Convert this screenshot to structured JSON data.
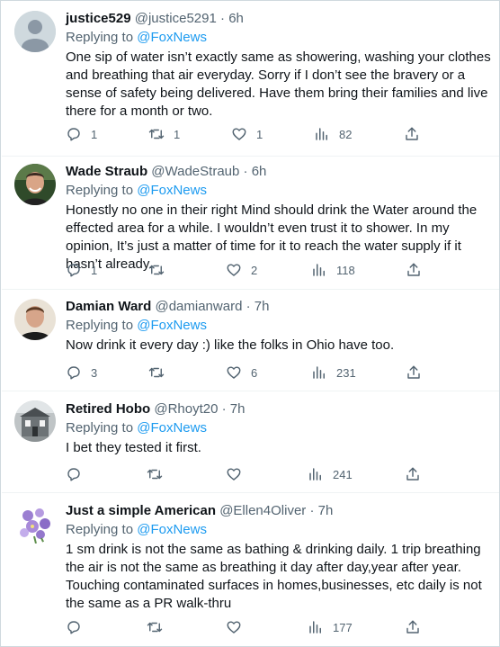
{
  "tweets": [
    {
      "name": "justice529",
      "handle": "@justice5291",
      "time": "6h",
      "replying_prefix": "Replying to",
      "replying_to": "@FoxNews",
      "text": "One sip of water isn’t exactly same as showering, washing your clothes and breathing that air everyday. Sorry if I don’t see the bravery or a sense of safety being delivered. Have them bring their families and live there for a month or two.",
      "replies": "1",
      "retweets": "1",
      "likes": "1",
      "views": "82",
      "avatar": "default-avatar"
    },
    {
      "name": "Wade Straub",
      "handle": "@WadeStraub",
      "time": "6h",
      "replying_prefix": "Replying to",
      "replying_to": "@FoxNews",
      "text": "Honestly no one in their right Mind should drink the Water around the effected area for a while. I wouldn’t even trust it to shower. In my opinion, It’s just a matter of time for it to reach the water supply if it hasn’t already.",
      "replies": "1",
      "retweets": "",
      "likes": "2",
      "views": "118",
      "avatar": "photo-avatar"
    },
    {
      "name": "Damian Ward",
      "handle": "@damianward",
      "time": "7h",
      "replying_prefix": "Replying to",
      "replying_to": "@FoxNews",
      "text": "Now drink it every day :) like the folks in Ohio have too.",
      "replies": "3",
      "retweets": "",
      "likes": "6",
      "views": "231",
      "avatar": "photo-avatar"
    },
    {
      "name": "Retired Hobo",
      "handle": "@Rhoyt20",
      "time": "7h",
      "replying_prefix": "Replying to",
      "replying_to": "@FoxNews",
      "text": "I bet they tested it first.",
      "replies": "",
      "retweets": "",
      "likes": "",
      "views": "241",
      "avatar": "photo-avatar"
    },
    {
      "name": "Just a simple American",
      "handle": "@Ellen4Oliver",
      "time": "7h",
      "replying_prefix": "Replying to",
      "replying_to": "@FoxNews",
      "text": "1 sm drink is not the same as bathing & drinking daily. 1 trip breathing the air is not the same as breathing it day after day,year after year. Touching contaminated surfaces in homes,businesses, etc daily is not the same as a PR walk-thru",
      "replies": "",
      "retweets": "",
      "likes": "",
      "views": "177",
      "avatar": "flower-avatar"
    }
  ],
  "separator": "·",
  "icons": [
    "reply-icon",
    "retweet-icon",
    "like-icon",
    "views-icon",
    "share-icon"
  ],
  "colors": {
    "text": "#0f1419",
    "muted": "#536471",
    "link": "#1d9bf0",
    "divider": "#eff3f4"
  }
}
